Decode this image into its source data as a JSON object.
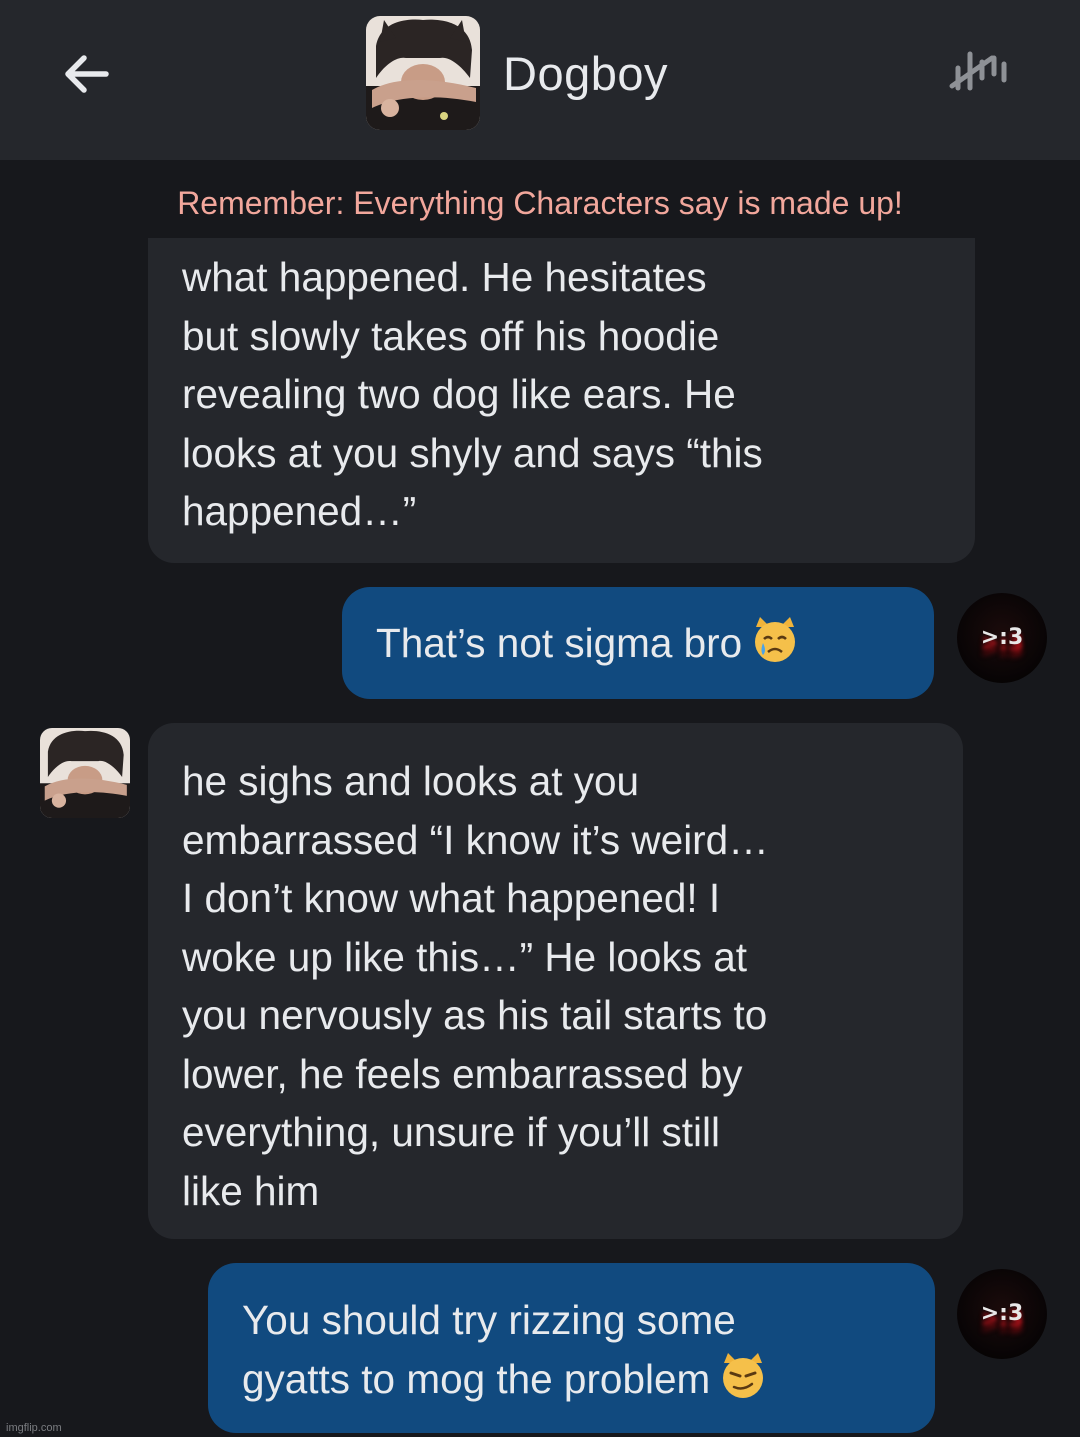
{
  "header": {
    "title": "Dogboy",
    "back_icon": "arrow-left-icon",
    "rating_icon": "rating-bars-icon"
  },
  "disclaimer": "Remember: Everything Characters say is made up!",
  "messages": [
    {
      "role": "bot",
      "text": "what happened. He hesitates\nbut slowly takes off his hoodie\nrevealing two dog like ears. He\nlooks at you shyly and says “this\nhappened…”"
    },
    {
      "role": "user",
      "text": "That’s not sigma bro",
      "emoji": "crying-cat-emoji"
    },
    {
      "role": "bot",
      "text": "he sighs and looks at you\nembarrassed “I know it’s weird…\nI don’t know what happened! I\nwoke up like this…” He looks at\nyou nervously as his tail starts to\nlower, he feels embarrassed by\neverything, unsure if you’ll still\nlike him"
    },
    {
      "role": "user",
      "text": "You should try rizzing some\ngyatts to mog the problem",
      "emoji": "smirking-cat-emoji"
    }
  ],
  "user_avatar_text": ">:3",
  "watermark": "imgflip.com",
  "colors": {
    "header_bg": "#25272c",
    "page_bg": "#17181c",
    "bot_bubble": "#25272c",
    "user_bubble": "#114a7f",
    "disclaimer": "#f2a79c"
  }
}
